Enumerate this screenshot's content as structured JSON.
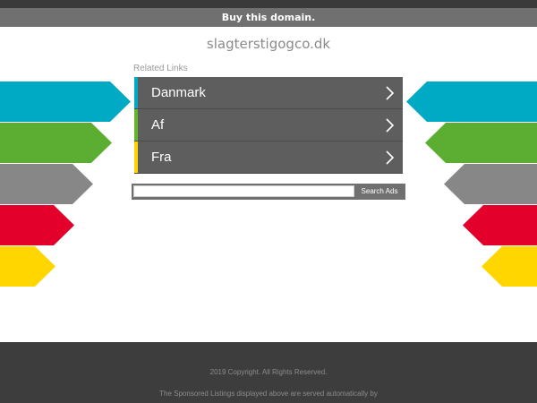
{
  "banner": {
    "buy_label": "Buy this domain."
  },
  "domain": {
    "name": "slagterstigogco.dk"
  },
  "related": {
    "title": "Related Links",
    "links": [
      {
        "label": "Danmark",
        "accent": "#00a9c4"
      },
      {
        "label": "Af",
        "accent": "#66b32e"
      },
      {
        "label": "Fra",
        "accent": "#ffd200"
      }
    ]
  },
  "search": {
    "placeholder": "",
    "button_label": "Search Ads"
  },
  "decor": {
    "colors": [
      "#00a9c4",
      "#5bae32",
      "#878787",
      "#e3002b",
      "#ffd600"
    ]
  },
  "footer": {
    "copyright": "2019 Copyright. All Rights Reserved.",
    "disclaimer": "The Sponsored Listings displayed above are served automatically by"
  }
}
